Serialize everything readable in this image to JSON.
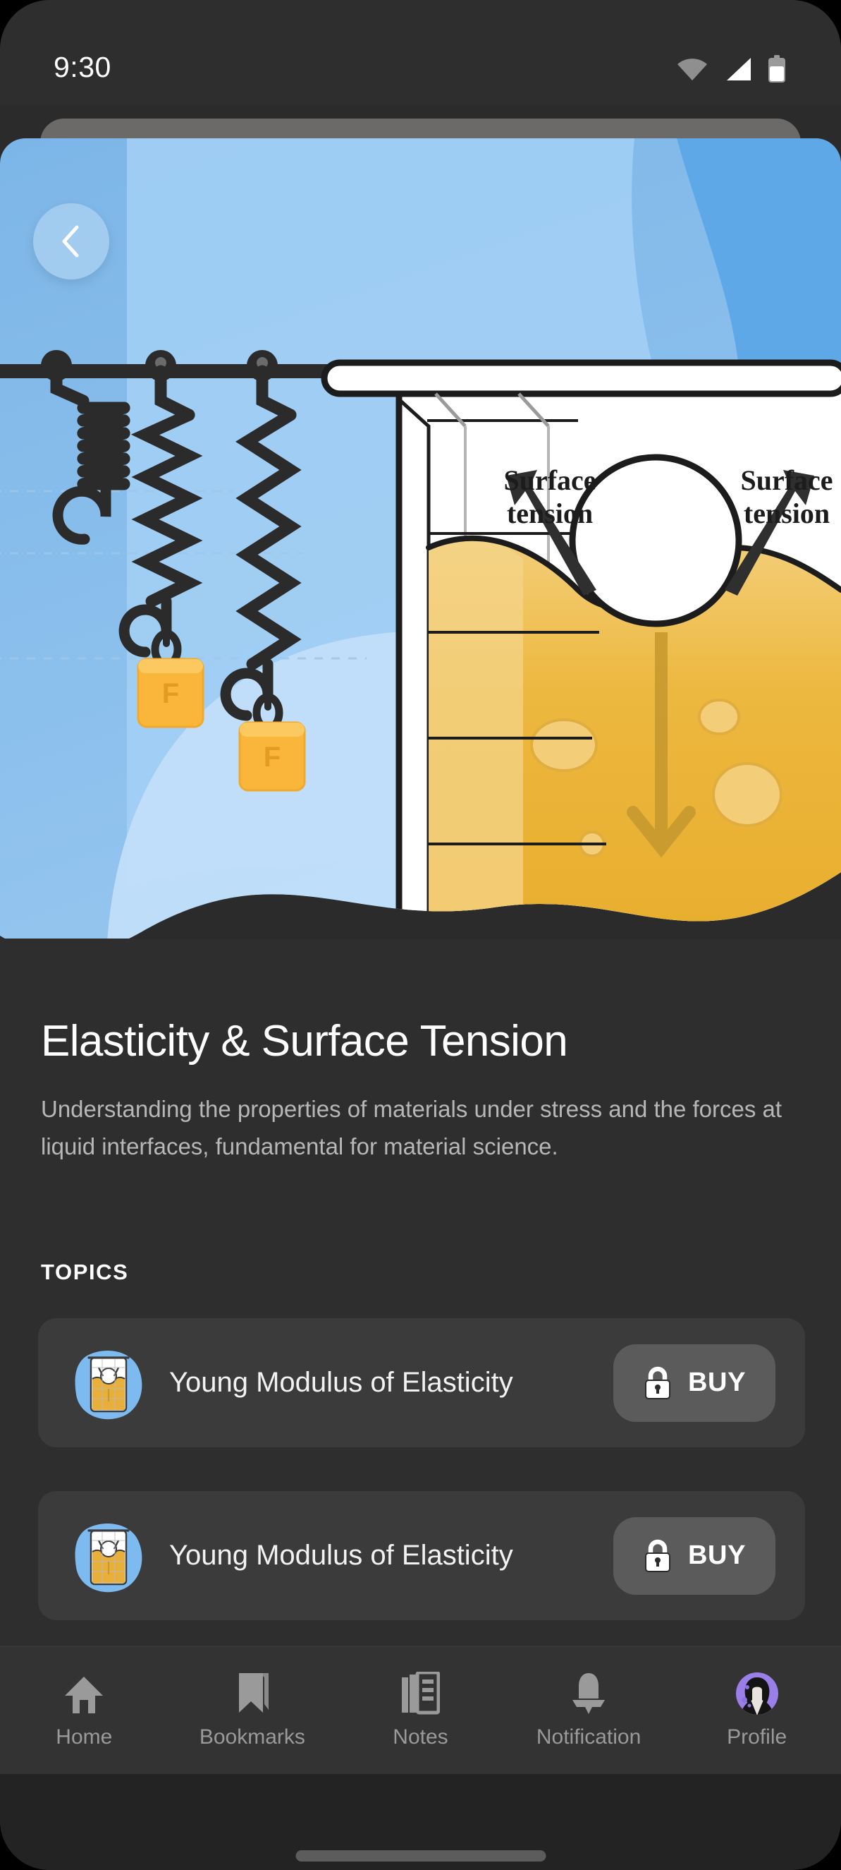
{
  "status_bar": {
    "time": "9:30",
    "icons": [
      "wifi-icon",
      "cellular-signal-icon",
      "battery-icon"
    ]
  },
  "header": {
    "back_button_icon": "chevron-left-icon",
    "hero_illustration": {
      "name": "elasticity-surface-tension-illustration",
      "annotations": [
        "Surface tension",
        "Surface tension"
      ],
      "weight_labels": [
        "F",
        "F"
      ],
      "colors": {
        "sky_dark": "#5fa8e8",
        "sky_mid": "#8cc4f0",
        "sky_light": "#b8dcf8",
        "liquid": "#edb63e",
        "liquid_light": "#f2cd76",
        "ink": "#1c1c1c",
        "glass": "#ffffff"
      }
    }
  },
  "content": {
    "title": "Elasticity & Surface Tension",
    "description": "Understanding the properties of materials under stress and the forces at liquid interfaces, fundamental for material science.",
    "topics_heading": "TOPICS"
  },
  "topics": [
    {
      "label": "Young Modulus of Elasticity",
      "thumbnail": "beaker-surface-tension-thumbnail",
      "action_label": "BUY",
      "action_icon": "lock-icon",
      "locked": true
    },
    {
      "label": "Young Modulus of Elasticity",
      "thumbnail": "beaker-surface-tension-thumbnail",
      "action_label": "BUY",
      "action_icon": "lock-icon",
      "locked": true
    }
  ],
  "bottom_nav": {
    "active": "Profile",
    "items": [
      {
        "label": "Home",
        "icon": "home-icon"
      },
      {
        "label": "Bookmarks",
        "icon": "bookmark-icon"
      },
      {
        "label": "Notes",
        "icon": "notes-icon"
      },
      {
        "label": "Notification",
        "icon": "bell-icon"
      },
      {
        "label": "Profile",
        "icon": "avatar-icon"
      }
    ]
  },
  "theme": {
    "page_bg": "#2e2e2e",
    "card_bg": "#3b3b3b",
    "button_bg": "#5b5b5b",
    "text_primary": "#ffffff",
    "text_secondary": "#b7b7b7",
    "nav_inactive": "#9a9a9a",
    "accent_purple": "#9b7fe8"
  }
}
